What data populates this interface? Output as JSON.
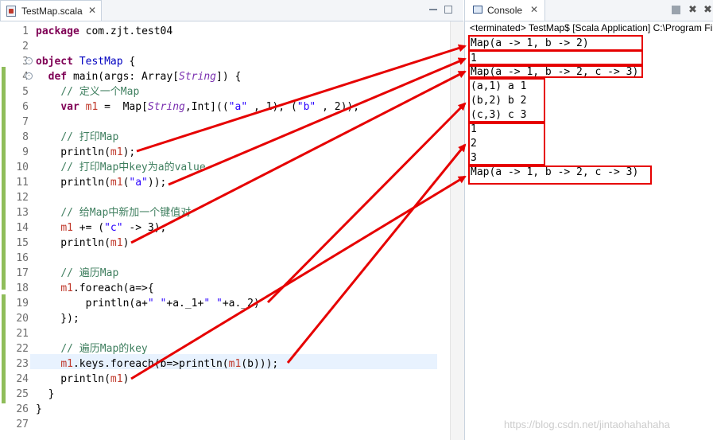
{
  "editor": {
    "tab_label": "TestMap.scala",
    "close_glyph": "✕",
    "lines": [
      {
        "n": "1",
        "html": "<span class='kw'>package</span> com.zjt.test04"
      },
      {
        "n": "2",
        "html": ""
      },
      {
        "n": "3",
        "html": "<span class='kw'>object</span> <span class='cls'>TestMap</span> {"
      },
      {
        "n": "4",
        "html": "  <span class='kw'>def</span> main(args: Array[<span class='it'>String</span>]) {"
      },
      {
        "n": "5",
        "html": "    <span class='cm'>// 定义一个Map</span>"
      },
      {
        "n": "6",
        "html": "    <span class='kw'>var</span> <span class='vr'>m1</span> =  Map[<span class='it'>String</span>,Int]((<span class='st'>\"a\"</span> , 1), (<span class='st'>\"b\"</span> , 2));"
      },
      {
        "n": "7",
        "html": ""
      },
      {
        "n": "8",
        "html": "    <span class='cm'>// 打印Map</span>"
      },
      {
        "n": "9",
        "html": "    println(<span class='vr'>m1</span>);"
      },
      {
        "n": "10",
        "html": "    <span class='cm'>// 打印Map中key为a的value</span>"
      },
      {
        "n": "11",
        "html": "    println(<span class='vr'>m1</span>(<span class='st'>\"a\"</span>));"
      },
      {
        "n": "12",
        "html": ""
      },
      {
        "n": "13",
        "html": "    <span class='cm'>// 给Map中新加一个键值对</span>"
      },
      {
        "n": "14",
        "html": "    <span class='vr'>m1</span> += (<span class='st'>\"c\"</span> -> 3);"
      },
      {
        "n": "15",
        "html": "    println(<span class='vr'>m1</span>)"
      },
      {
        "n": "16",
        "html": ""
      },
      {
        "n": "17",
        "html": "    <span class='cm'>// 遍历Map</span>"
      },
      {
        "n": "18",
        "html": "    <span class='vr'>m1</span>.foreach(a=>{"
      },
      {
        "n": "19",
        "html": "        println(a+<span class='st'>\" \"</span>+a._1+<span class='st'>\" \"</span>+a._2)"
      },
      {
        "n": "20",
        "html": "    });"
      },
      {
        "n": "21",
        "html": ""
      },
      {
        "n": "22",
        "html": "    <span class='cm'>// 遍历Map的key</span>"
      },
      {
        "n": "23",
        "html": "    <span class='vr'>m1</span>.keys.foreach(b=>println(<span class='vr'>m1</span>(b)));"
      },
      {
        "n": "24",
        "html": "    println(<span class='vr'>m1</span>)"
      },
      {
        "n": "25",
        "html": "  }"
      },
      {
        "n": "26",
        "html": "}"
      },
      {
        "n": "27",
        "html": ""
      }
    ]
  },
  "console": {
    "tab_label": "Console",
    "terminated_text": "<terminated> TestMap$ [Scala Application] C:\\Program Fi",
    "output": [
      "Map(a -> 1, b -> 2)",
      "1",
      "Map(a -> 1, b -> 2, c -> 3)",
      "(a,1) a 1",
      "(b,2) b 2",
      "(c,3) c 3",
      "1",
      "2",
      "3",
      "Map(a -> 1, b -> 2, c -> 3)"
    ]
  },
  "watermark": "https://blog.csdn.net/jintaohahahaha",
  "colors": {
    "annotation": "#e60000",
    "change_bar": "#8fbd5a"
  }
}
